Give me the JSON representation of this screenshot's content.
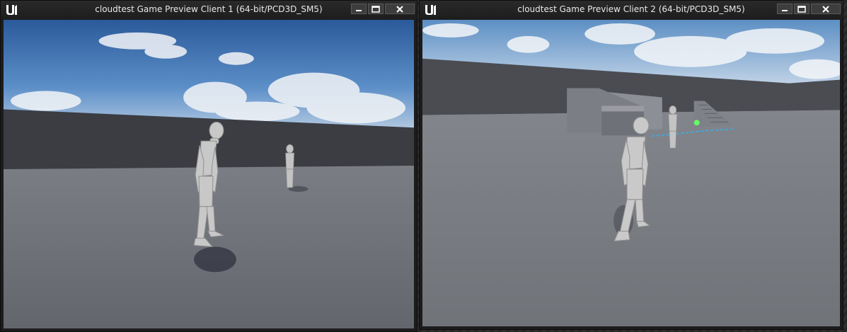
{
  "windows": [
    {
      "title": "cloudtest Game Preview Client 1 (64-bit/PCD3D_SM5)",
      "icon": "unreal-logo-icon",
      "buttons": [
        "minimize-icon",
        "maximize-icon",
        "close-icon"
      ]
    },
    {
      "title": "cloudtest Game Preview Client 2 (64-bit/PCD3D_SM5)",
      "icon": "unreal-logo-icon",
      "buttons": [
        "minimize-icon",
        "maximize-icon",
        "close-icon"
      ]
    }
  ],
  "colors": {
    "titlebar": "#1d1d1d",
    "title_text": "#e8e8e8",
    "sky_top": "#2f5f9e",
    "floor": "#6d7077",
    "wall": "#3a3c41",
    "mannequin": "#c9c9c9",
    "accent_cyan": "#3fa9e0",
    "accent_green": "#66ff66"
  }
}
